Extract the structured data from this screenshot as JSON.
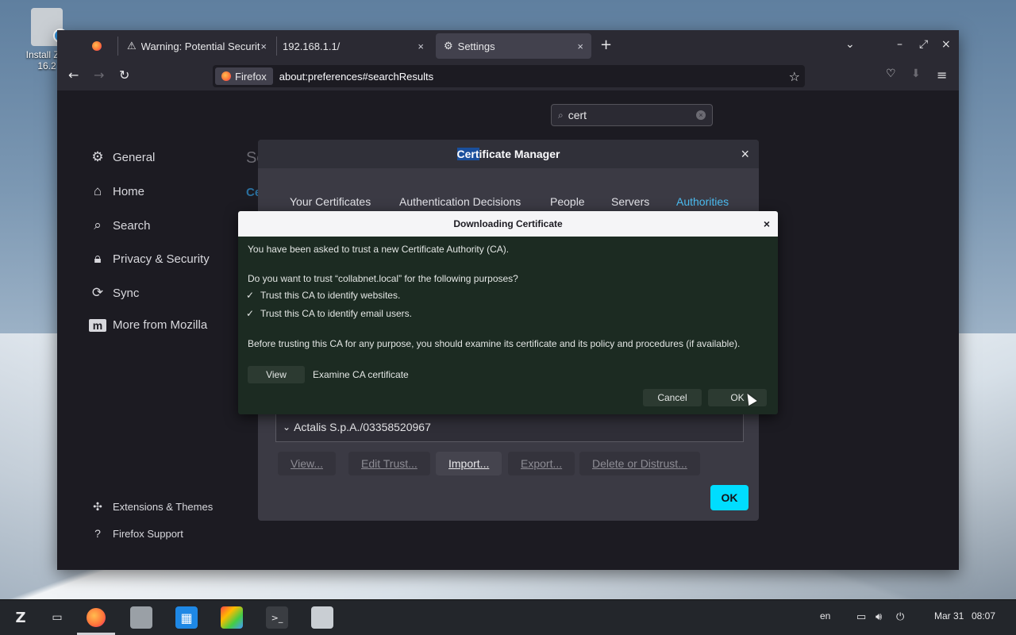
{
  "desktop": {
    "icon_label_line1": "Install Zor",
    "icon_label_line2": "16.2"
  },
  "browser": {
    "tabs": [
      {
        "label": "",
        "icon": "firefox-icon"
      },
      {
        "label": "Warning: Potential Securit",
        "icon": "warning-icon",
        "close": "×"
      },
      {
        "label": "192.168.1.1/",
        "close": "×"
      },
      {
        "label": "Settings",
        "icon": "gear-icon",
        "close": "×",
        "active": true
      }
    ],
    "new_tab": "+",
    "window_controls": {
      "list_tabs": "⌄",
      "minimize": "–",
      "maximize": "⤢",
      "close": "×"
    },
    "nav": {
      "back": "←",
      "forward": "→",
      "reload": "↻"
    },
    "url_badge": "Firefox",
    "url": "about:preferences#searchResults",
    "bookmark_star": "☆"
  },
  "settings": {
    "search_value": "cert",
    "sidebar": [
      {
        "label": "General",
        "icon": "gear-icon"
      },
      {
        "label": "Home",
        "icon": "home-icon"
      },
      {
        "label": "Search",
        "icon": "search-icon"
      },
      {
        "label": "Privacy & Security",
        "icon": "lock-icon"
      },
      {
        "label": "Sync",
        "icon": "sync-icon"
      },
      {
        "label": "More from Mozilla",
        "icon": "mozilla-icon"
      }
    ],
    "footer": [
      {
        "label": "Extensions & Themes",
        "icon": "puzzle-icon"
      },
      {
        "label": "Firefox Support",
        "icon": "help-icon"
      }
    ],
    "heading_fragment": "Se",
    "link_fragment": "Ce"
  },
  "cert_manager": {
    "title_highlight": "Cert",
    "title_rest": "ificate Manager",
    "close": "×",
    "tabs": [
      "Your Certificates",
      "Authentication Decisions",
      "People",
      "Servers",
      "Authorities"
    ],
    "active_tab": "Authorities",
    "row": "Actalis S.p.A./03358520967",
    "row_toggle": "⌄",
    "buttons": [
      "View...",
      "Edit Trust...",
      "Import...",
      "Export...",
      "Delete or Distrust..."
    ],
    "ok": "OK"
  },
  "download_dialog": {
    "title": "Downloading Certificate",
    "close": "×",
    "intro": "You have been asked to trust a new Certificate Authority (CA).",
    "question": "Do you want to trust “collabnet.local” for the following purposes?",
    "options": [
      {
        "label": "Trust this CA to identify websites.",
        "checked": true
      },
      {
        "label": "Trust this CA to identify email users.",
        "checked": true
      }
    ],
    "check_mark": "✓",
    "advice": "Before trusting this CA for any purpose, you should examine its certificate and its policy and procedures (if available).",
    "view_button": "View",
    "examine_label": "Examine CA certificate",
    "cancel": "Cancel",
    "ok": "OK"
  },
  "taskbar": {
    "apps": [
      "zorin-menu-icon",
      "workspace-icon",
      "firefox-icon",
      "files-icon",
      "store-icon",
      "color-picker-icon",
      "terminal-icon",
      "installer-icon"
    ],
    "language": "en",
    "date": "Mar 31",
    "time": "08:07"
  }
}
